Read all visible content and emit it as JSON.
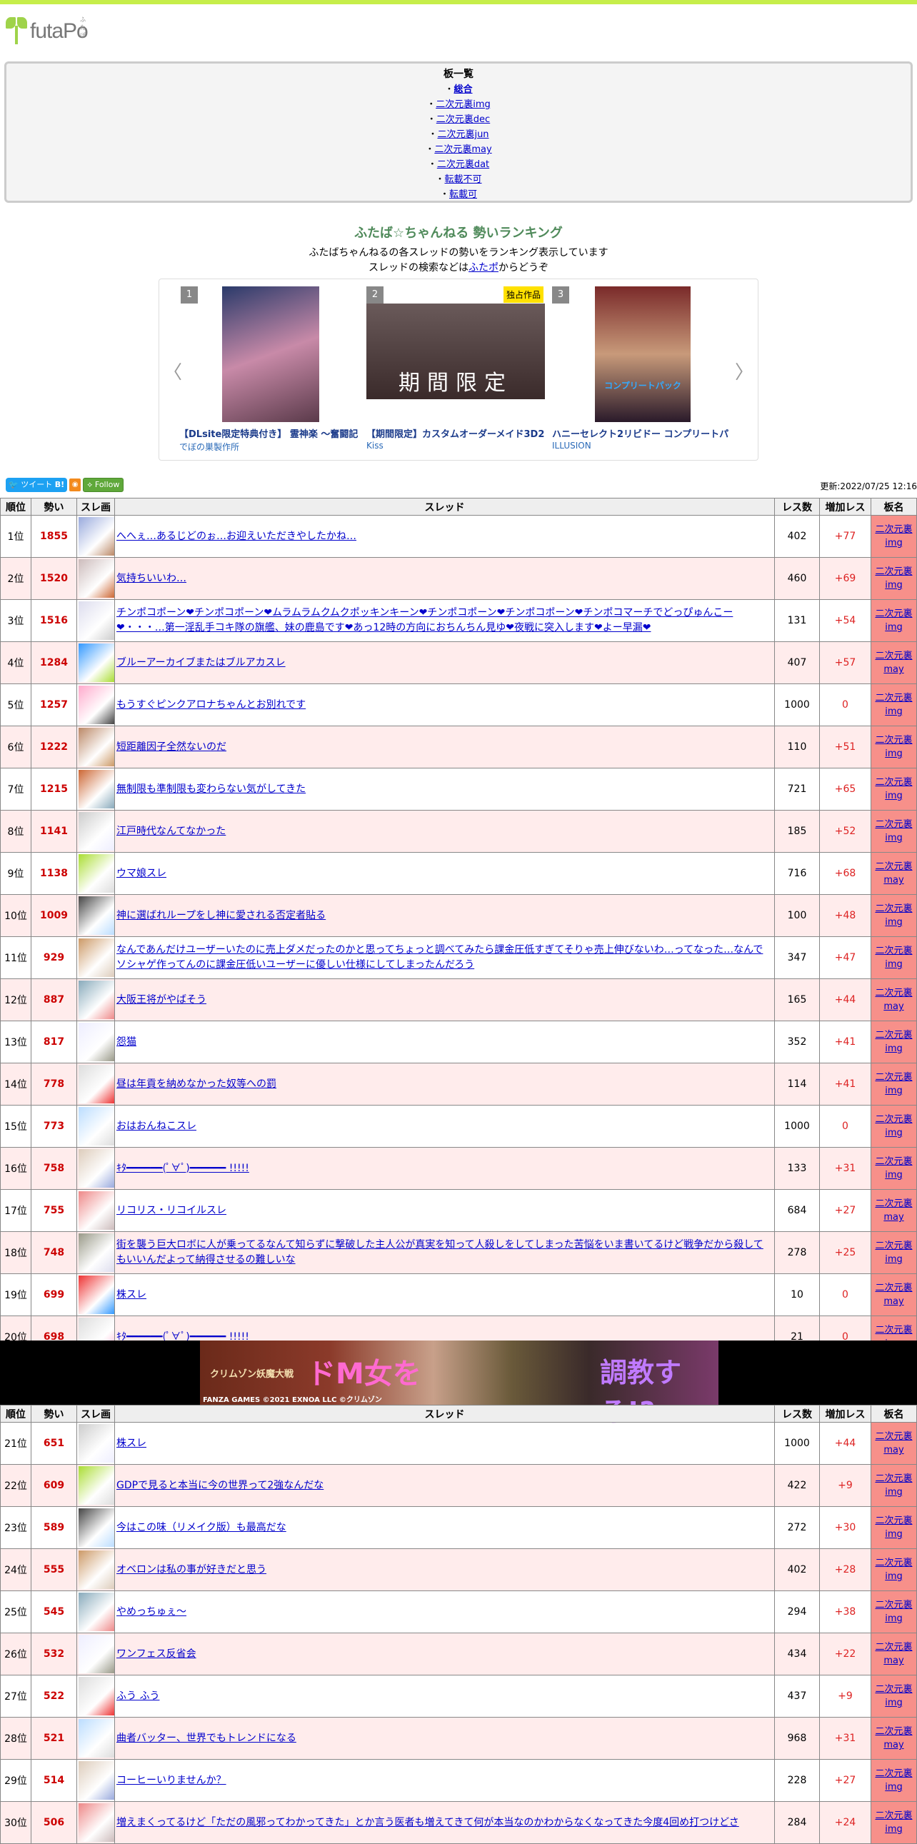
{
  "logo": {
    "text": "futaPo",
    "kana": "ふたぽ"
  },
  "boards": {
    "heading": "板一覧",
    "items": [
      "総合",
      "二次元裏img",
      "二次元裏dec",
      "二次元裏jun",
      "二次元裏may",
      "二次元裏dat",
      "転載不可",
      "転載可"
    ]
  },
  "ranking": {
    "title": "ふたば☆ちゃんねる 勢いランキング",
    "desc1": "ふたばちゃんねるの各スレッドの勢いをランキング表示しています",
    "desc2_pre": "スレッドの検索などは",
    "desc2_link": "ふたポ",
    "desc2_post": "からどうぞ"
  },
  "carousel": {
    "items": [
      {
        "num": "1",
        "title": "【DLsite限定特典付き】 霊神楽 ～奮闘記",
        "maker": "でぼの巣製作所",
        "color": "#6a4a7a"
      },
      {
        "num": "2",
        "title": "【期間限定】カスタムオーダーメイド3D2",
        "maker": "Kiss",
        "badge": "独占作品",
        "caption": "期間限定",
        "color": "#4a3a3a"
      },
      {
        "num": "3",
        "title": "ハニーセレクト2リビドー コンプリートパ",
        "maker": "ILLUSION",
        "caption": "コンプリートパック",
        "color": "#8a3a3a"
      }
    ]
  },
  "share": {
    "tweet": "ツイート",
    "hatena": "B!",
    "rss": "RSS",
    "follow": "Follow"
  },
  "updated": "更新:2022/07/25 12:16",
  "table": {
    "headers": [
      "順位",
      "勢い",
      "スレ画",
      "スレッド",
      "レス数",
      "増加レス",
      "板名"
    ],
    "rows": [
      [
        "1位",
        "1855",
        "へへぇ…あるじどのぉ…お迎えいただきやしたかね…",
        "402",
        "+77",
        "img"
      ],
      [
        "2位",
        "1520",
        "気持ちいいわ…",
        "460",
        "+69",
        "img"
      ],
      [
        "3位",
        "1516",
        "チンポコポーン❤チンポコポーン❤ムラムラムクムクポッキンキーン❤チンポコポーン❤チンポコポーン❤チンポコマーチでどっぴゅんこー❤・・・…第一淫乱手コキ隊の旗艦、妹の鹿島です❤あっ12時の方向におちんちん見ゆ❤夜戦に突入します❤よー早漏❤",
        "131",
        "+54",
        "img"
      ],
      [
        "4位",
        "1284",
        "ブルーアーカイブまたはブルアカスレ",
        "407",
        "+57",
        "may"
      ],
      [
        "5位",
        "1257",
        "もうすぐピンクアロナちゃんとお別れです",
        "1000",
        "0",
        "img"
      ],
      [
        "6位",
        "1222",
        "短距離因子全然ないのだ",
        "110",
        "+51",
        "img"
      ],
      [
        "7位",
        "1215",
        "無制限も準制限も変わらない気がしてきた",
        "721",
        "+65",
        "img"
      ],
      [
        "8位",
        "1141",
        "江戸時代なんてなかった",
        "185",
        "+52",
        "img"
      ],
      [
        "9位",
        "1138",
        "ウマ娘スレ",
        "716",
        "+68",
        "may"
      ],
      [
        "10位",
        "1009",
        "神に選ばれループをし神に愛される否定者貼る",
        "100",
        "+48",
        "img"
      ],
      [
        "11位",
        "929",
        "なんであんだけユーザーいたのに売上ダメだったのかと思ってちょっと調べてみたら課金圧低すぎてそりゃ売上伸びないわ…ってなった…なんでソシャゲ作ってんのに課金圧低いユーザーに優しい仕様にしてしまったんだろう",
        "347",
        "+47",
        "img"
      ],
      [
        "12位",
        "887",
        "大阪王将がやばそう",
        "165",
        "+44",
        "may"
      ],
      [
        "13位",
        "817",
        "怨猫",
        "352",
        "+41",
        "img"
      ],
      [
        "14位",
        "778",
        "昼は年貢を納めなかった奴等への罰",
        "114",
        "+41",
        "img"
      ],
      [
        "15位",
        "773",
        "おはおんねこスレ",
        "1000",
        "0",
        "img"
      ],
      [
        "16位",
        "758",
        "ｷﾀ━━━━━━(ﾟ∀ﾟ)━━━━━━ !!!!!",
        "133",
        "+31",
        "img"
      ],
      [
        "17位",
        "755",
        "リコリス・リコイルスレ",
        "684",
        "+27",
        "may"
      ],
      [
        "18位",
        "748",
        "街を襲う巨大ロボに人が乗ってるなんて知らずに撃破した主人公が真実を知って人殺しをしてしまった苦悩をいま書いてるけど戦争だから殺してもいいんだよって納得させるの難しいな",
        "278",
        "+25",
        "img"
      ],
      [
        "19位",
        "699",
        "株スレ",
        "10",
        "0",
        "may"
      ],
      [
        "20位",
        "698",
        "ｷﾀ━━━━━━(ﾟ∀ﾟ)━━━━━━ !!!!!",
        "21",
        "0",
        "img"
      ]
    ],
    "rows2": [
      [
        "21位",
        "651",
        "株スレ",
        "1000",
        "+44",
        "may"
      ],
      [
        "22位",
        "609",
        "GDPで見ると本当に今の世界って2強なんだな",
        "422",
        "+9",
        "img"
      ],
      [
        "23位",
        "589",
        "今はこの味（リメイク版）も最高だな",
        "272",
        "+30",
        "img"
      ],
      [
        "24位",
        "555",
        "オベロンは私の事が好きだと思う",
        "402",
        "+28",
        "img"
      ],
      [
        "25位",
        "545",
        "やめっちゅぇ〜",
        "294",
        "+38",
        "img"
      ],
      [
        "26位",
        "532",
        "ワンフェス反省会",
        "434",
        "+22",
        "may"
      ],
      [
        "27位",
        "522",
        "ふう ふう",
        "437",
        "+9",
        "img"
      ],
      [
        "28位",
        "521",
        "曲者バッター、世界でもトレンドになる",
        "968",
        "+31",
        "may"
      ],
      [
        "29位",
        "514",
        "コーヒーいりませんか？",
        "228",
        "+27",
        "img"
      ],
      [
        "30位",
        "506",
        "増えまくってるけど「ただの風邪ってわかってきた」とか言う医者も増えてきて何が本当なのかわからなくなってきた今度4回め打つけどさ",
        "284",
        "+24",
        "img"
      ]
    ],
    "board_prefix": "二次元裏"
  },
  "banner": {
    "title": "クリムゾン妖魔大戦",
    "copy1": "ドM女を",
    "copy2": "調教する!?",
    "credit": "FANZA GAMES ©2021 EXNOA LLC ©クリムゾン"
  }
}
